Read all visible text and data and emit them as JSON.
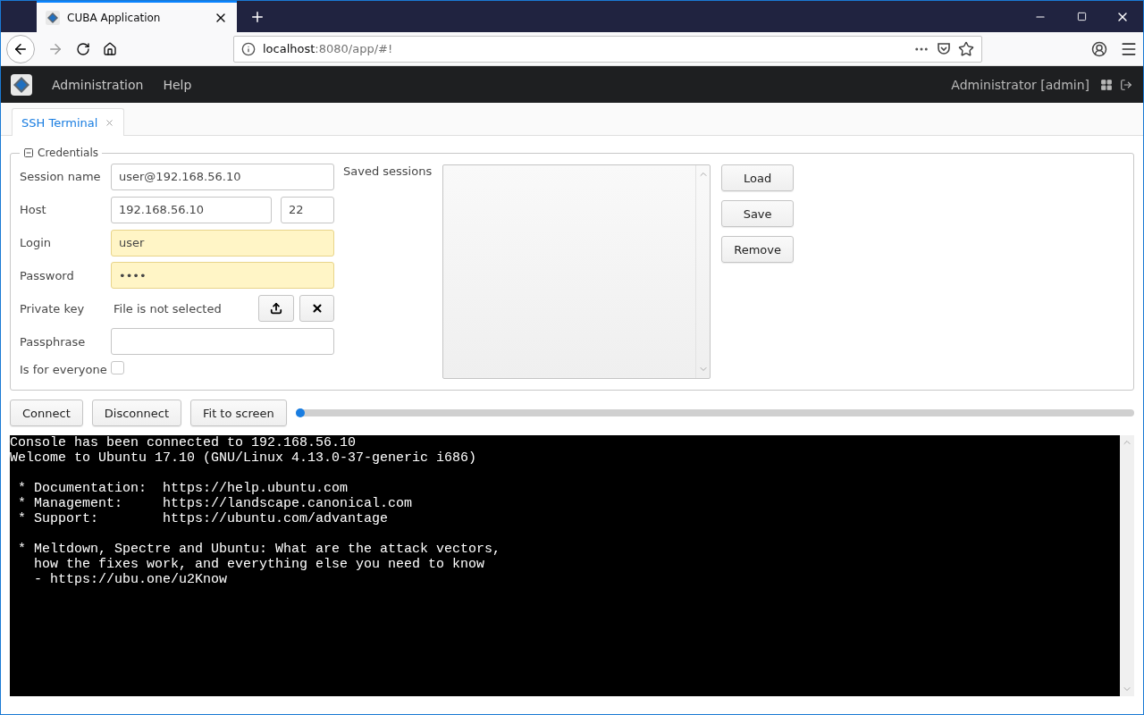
{
  "browser": {
    "tab_title": "CUBA Application",
    "url_host": "localhost",
    "url_rest": ":8080/app/#!"
  },
  "app_header": {
    "menu": [
      "Administration",
      "Help"
    ],
    "user": "Administrator [admin]"
  },
  "tabs": [
    {
      "label": "SSH Terminal",
      "selected": true
    }
  ],
  "credentials": {
    "legend": "Credentials",
    "expanded": true,
    "fields": [
      {
        "label": "Session name",
        "value": "user@192.168.56.10",
        "highlighted": false
      },
      {
        "label": "Host",
        "value": "192.168.56.10",
        "port": "22",
        "highlighted": false
      },
      {
        "label": "Login",
        "value": "user",
        "highlighted": true
      },
      {
        "label": "Password",
        "value": "••••",
        "highlighted": true
      }
    ],
    "private_key": {
      "label": "Private key",
      "status": "File is not selected"
    },
    "passphrase": {
      "label": "Passphrase",
      "highlighted": false
    },
    "is_for_everyone": {
      "label": "Is for everyone",
      "checked": false
    },
    "saved_sessions": {
      "label": "Saved sessions"
    },
    "session_buttons": [
      "Load",
      "Save",
      "Remove"
    ]
  },
  "actions": [
    "Connect",
    "Disconnect",
    "Fit to screen"
  ],
  "progress": {
    "level": 0
  },
  "terminal": {
    "blocks": [
      [
        "Console has been connected to 192.168.56.10",
        "Welcome to Ubuntu 17.10 (GNU/Linux 4.13.0-37-generic i686)"
      ],
      [
        " * Documentation:  https://help.ubuntu.com",
        " * Management:     https://landscape.canonical.com",
        " * Support:        https://ubuntu.com/advantage"
      ],
      [
        " * Meltdown, Spectre and Ubuntu: What are the attack vectors,",
        "   how the fixes work, and everything else you need to know",
        "   - https://ubu.one/u2Know"
      ]
    ]
  }
}
